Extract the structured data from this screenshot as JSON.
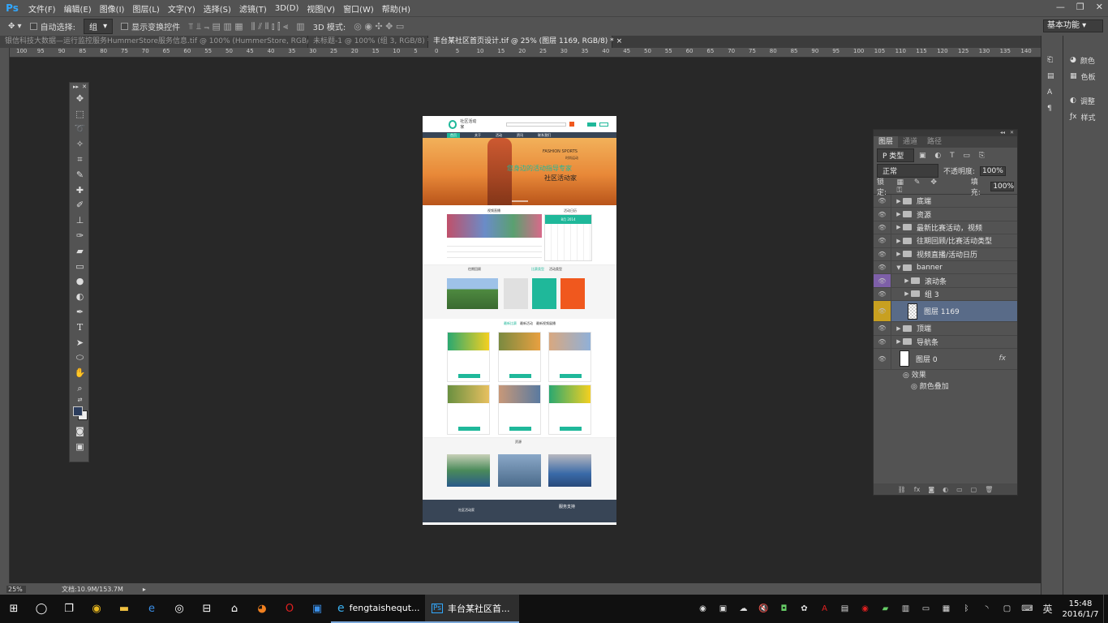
{
  "app": {
    "logo": "Ps"
  },
  "menubar": {
    "items": [
      "文件(F)",
      "编辑(E)",
      "图像(I)",
      "图层(L)",
      "文字(Y)",
      "选择(S)",
      "滤镜(T)",
      "3D(D)",
      "视图(V)",
      "窗口(W)",
      "帮助(H)"
    ]
  },
  "options": {
    "auto_select": "自动选择:",
    "group": "组",
    "show_transform": "显示变换控件",
    "mode_3d": "3D 模式:",
    "workspace": "基本功能"
  },
  "tabs": [
    {
      "label": "银信科技大数据—运行监控服务HummerStore服务信息.tif @ 100% (HummerStore, RGB/8) *",
      "close": "×"
    },
    {
      "label": "未标题-1 @ 100% (组 3, RGB/8) *",
      "close": "×"
    },
    {
      "label": "丰台某社区首页设计.tif @ 25% (图层 1169, RGB/8) *",
      "close": "×"
    }
  ],
  "ruler": {
    "h": [
      "100",
      "95",
      "90",
      "85",
      "80",
      "75",
      "70",
      "65",
      "60",
      "55",
      "50",
      "45",
      "40",
      "35",
      "30",
      "25",
      "20",
      "15",
      "10",
      "5",
      "0",
      "5",
      "10",
      "15",
      "20",
      "25",
      "30",
      "35",
      "40",
      "45",
      "50",
      "55",
      "60",
      "65",
      "70",
      "75",
      "80",
      "85",
      "90",
      "95",
      "100",
      "105",
      "110",
      "115",
      "120",
      "125",
      "130",
      "135",
      "140",
      "145"
    ]
  },
  "status": {
    "zoom": "25%",
    "doc": "文档:10.9M/153.7M"
  },
  "dock": {
    "items": [
      {
        "icon": "palette-icon",
        "label": "颜色"
      },
      {
        "icon": "swatches-icon",
        "label": "色板"
      },
      {
        "icon": "adjust-icon",
        "label": "调整"
      },
      {
        "icon": "styles-icon",
        "label": "样式"
      }
    ]
  },
  "layers_panel": {
    "tabs": [
      "图层",
      "通道",
      "路径"
    ],
    "kind": "P 类型",
    "blend": "正常",
    "opacity_label": "不透明度:",
    "opacity": "100%",
    "lock_label": "锁定:",
    "fill_label": "填充:",
    "fill": "100%",
    "layers": [
      {
        "name": "底端",
        "type": "group",
        "indent": 0,
        "open": false
      },
      {
        "name": "资源",
        "type": "group",
        "indent": 0,
        "open": false
      },
      {
        "name": "最新比赛活动，视频",
        "type": "group",
        "indent": 0,
        "open": false
      },
      {
        "name": "往期回顾/比赛活动类型",
        "type": "group",
        "indent": 0,
        "open": false
      },
      {
        "name": "视频直播/活动日历",
        "type": "group",
        "indent": 0,
        "open": false
      },
      {
        "name": "banner",
        "type": "group",
        "indent": 0,
        "open": true
      },
      {
        "name": "滚动条",
        "type": "group",
        "indent": 1,
        "open": false,
        "eye_color": "#7d5fa8"
      },
      {
        "name": "组 3",
        "type": "group",
        "indent": 1,
        "open": false
      },
      {
        "name": "图层 1169",
        "type": "layer",
        "indent": 1,
        "selected": true,
        "eye_color": "#c8a020"
      },
      {
        "name": "顶端",
        "type": "group",
        "indent": 0,
        "open": false
      },
      {
        "name": "导航条",
        "type": "group",
        "indent": 0,
        "open": false
      },
      {
        "name": "图层 0",
        "type": "layer",
        "indent": 0,
        "fx": "fx"
      }
    ],
    "effects": "效果",
    "effect_item": "颜色叠加"
  },
  "document": {
    "site_name": "社区活动家",
    "nav": [
      "首页",
      "关于",
      "活动",
      "资讯",
      "联系我们"
    ],
    "banner_en": "FASHION SPORTS",
    "banner_sub": "时尚运动",
    "banner_line": "您身边的活动指导专家",
    "banner_title": "社区活动家",
    "sec1_left": "视频直播",
    "sec1_right": "活动日历",
    "calendar_month": "8月 2014",
    "sec2_left": "往期回顾",
    "sec2_mid": "比赛类型",
    "sec2_right": "活动类型",
    "sec3_tabs": [
      "最新比赛",
      "最新活动",
      "最新视频展播"
    ],
    "card_btn": "立即报名",
    "sec4": "资源",
    "footer_title": "服务支持",
    "footer_site": "社区活动家"
  },
  "taskbar": {
    "apps": [
      {
        "icon": "start-icon"
      },
      {
        "icon": "search-icon"
      },
      {
        "icon": "taskview-icon"
      },
      {
        "icon": "chrome-icon"
      },
      {
        "icon": "explorer-icon"
      },
      {
        "icon": "edge-icon"
      },
      {
        "icon": "qq-icon"
      },
      {
        "icon": "store-icon"
      },
      {
        "icon": "network-icon"
      },
      {
        "icon": "firefox-icon"
      },
      {
        "icon": "opera-icon"
      },
      {
        "icon": "app-icon"
      }
    ],
    "windows": [
      {
        "label": "fengtaishequt...",
        "icon": "ie-icon"
      },
      {
        "label": "丰台某社区首...",
        "icon": "ps-icon"
      }
    ],
    "time": "15:48",
    "date": "2016/1/7",
    "ime": "英"
  },
  "colors": {
    "teal": "#1fb89a",
    "orange": "#f0581e",
    "banner": "#e88838"
  }
}
